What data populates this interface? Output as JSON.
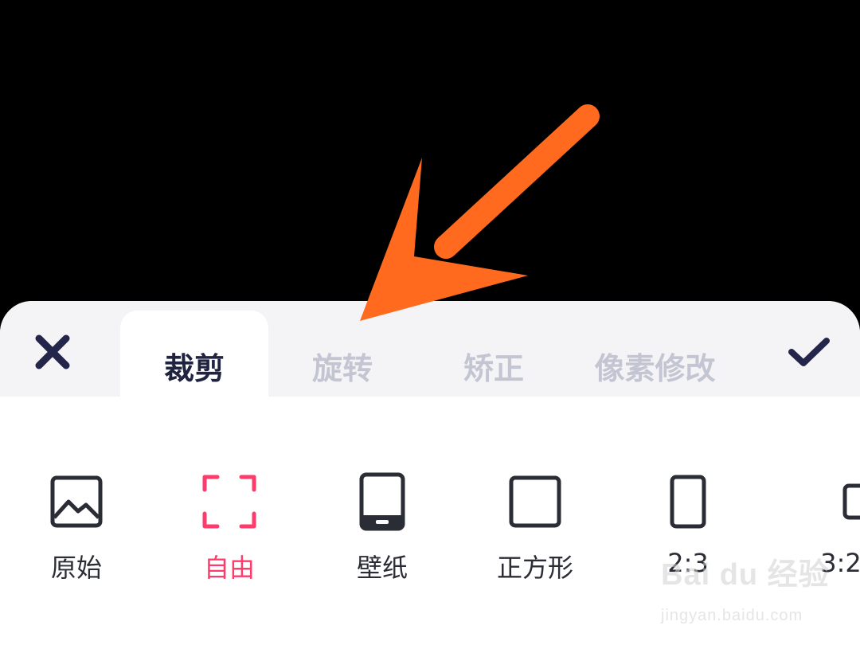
{
  "toolbar": {
    "close_icon": "close-icon",
    "confirm_icon": "checkmark-icon"
  },
  "tabs": [
    {
      "label": "裁剪",
      "active": true
    },
    {
      "label": "旋转",
      "active": false
    },
    {
      "label": "矫正",
      "active": false
    },
    {
      "label": "像素修改",
      "active": false
    }
  ],
  "ratios": [
    {
      "label": "原始",
      "icon": "image-icon",
      "selected": false
    },
    {
      "label": "自由",
      "icon": "free-crop-icon",
      "selected": true
    },
    {
      "label": "壁纸",
      "icon": "phone-icon",
      "selected": false
    },
    {
      "label": "正方形",
      "icon": "square-icon",
      "selected": false
    },
    {
      "label": "2:3",
      "icon": "portrait-ratio-icon",
      "selected": false
    },
    {
      "label": "3:2",
      "icon": "landscape-ratio-icon",
      "selected": false
    }
  ],
  "annotation": {
    "icon": "pointer-arrow-icon",
    "color": "#ff6a1f"
  },
  "watermark": {
    "brand": "Bai du 经验",
    "url": "jingyan.baidu.com"
  },
  "colors": {
    "active_tab_text": "#1f2340",
    "inactive_tab_text": "#c3c5d2",
    "selected_accent": "#ff3b6b",
    "icon_dark": "#2b2d36"
  }
}
